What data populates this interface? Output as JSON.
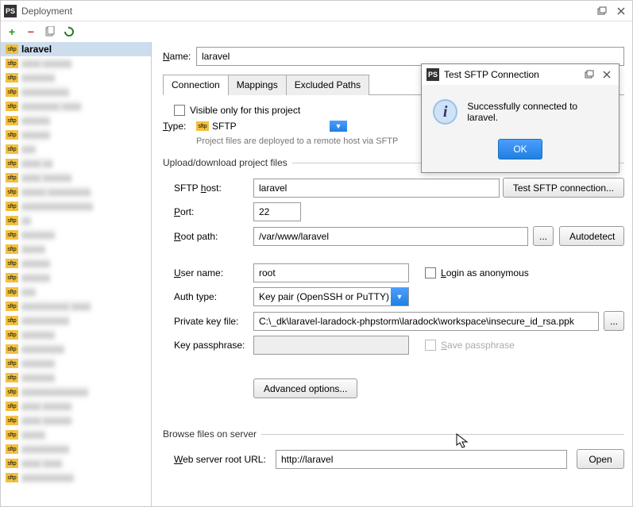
{
  "window_title": "Deployment",
  "toolbar": {
    "add": "+",
    "remove": "−"
  },
  "sidebar": {
    "selected_label": "laravel",
    "blurred_items": 30
  },
  "form": {
    "name_label": "Name:",
    "name_value": "laravel",
    "tabs": [
      "Connection",
      "Mappings",
      "Excluded Paths"
    ],
    "visible_only_label": "Visible only for this project",
    "type_label": "Type:",
    "type_value": "SFTP",
    "type_hint": "Project files are deployed to a remote host via SFTP"
  },
  "upload": {
    "legend": "Upload/download project files",
    "host_label": "SFTP host:",
    "host_value": "laravel",
    "test_btn": "Test SFTP connection...",
    "port_label": "Port:",
    "port_value": "22",
    "root_label": "Root path:",
    "root_value": "/var/www/laravel",
    "browse_btn": "...",
    "autodetect_btn": "Autodetect",
    "user_label": "User name:",
    "user_value": "root",
    "anon_label": "Login as anonymous",
    "auth_label": "Auth type:",
    "auth_value": "Key pair (OpenSSH or PuTTY)",
    "pk_label": "Private key file:",
    "pk_value": "C:\\_dk\\laravel-laradock-phpstorm\\laradock\\workspace\\insecure_id_rsa.ppk",
    "pass_label": "Key passphrase:",
    "pass_value": "",
    "save_pass_label": "Save passphrase",
    "advanced_btn": "Advanced options..."
  },
  "browse": {
    "legend": "Browse files on server",
    "url_label": "Web server root URL:",
    "url_value": "http://laravel",
    "open_btn": "Open"
  },
  "dialog": {
    "title": "Test SFTP Connection",
    "message": "Successfully connected to laravel.",
    "ok": "OK"
  }
}
